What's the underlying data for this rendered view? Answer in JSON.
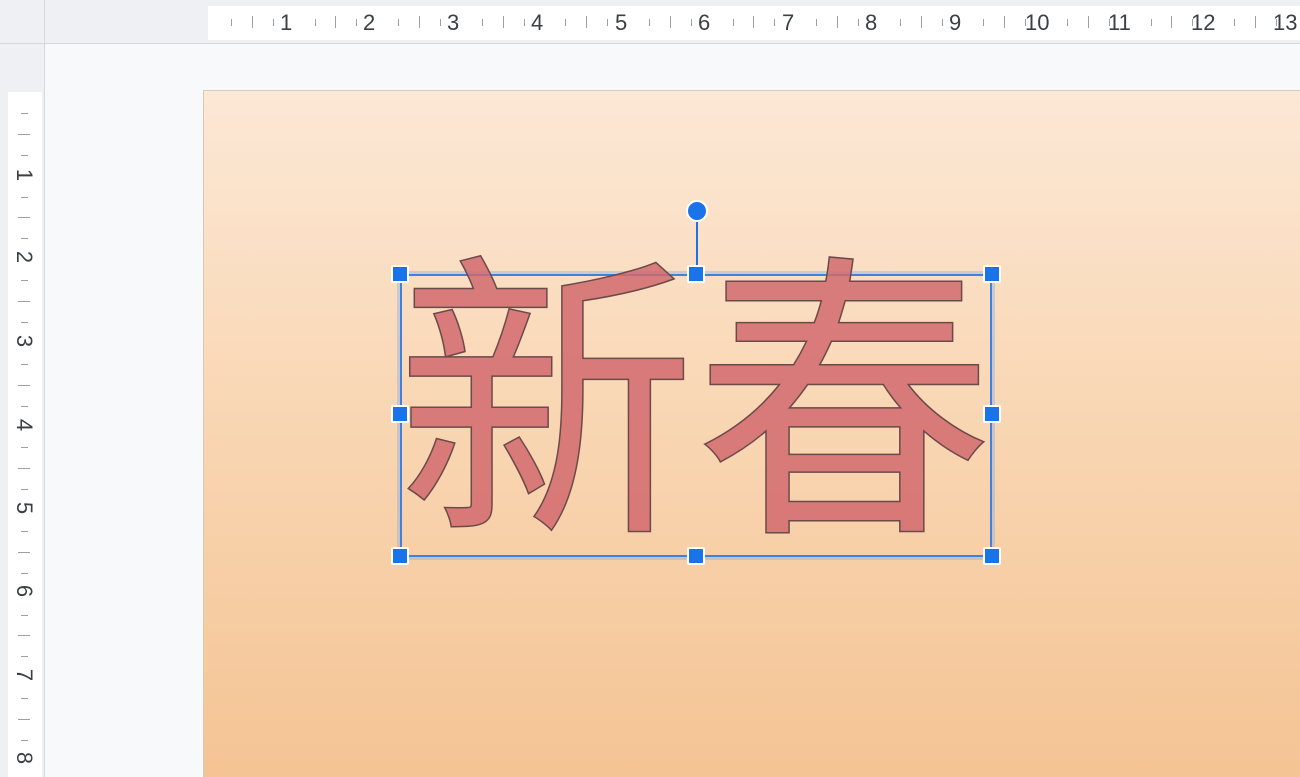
{
  "ruler": {
    "horizontal_labels": [
      "1",
      "2",
      "3",
      "4",
      "5",
      "6",
      "7",
      "8",
      "9",
      "10",
      "11",
      "12",
      "13"
    ],
    "vertical_labels": [
      "1",
      "2",
      "3",
      "4",
      "5",
      "6",
      "7",
      "8"
    ]
  },
  "slide": {
    "word_art_text": "新春"
  },
  "colors": {
    "selection": "#1a73e8",
    "slide_top": "#fce8d6",
    "slide_bottom": "#f4c393",
    "text_fill": "#dc6e73"
  }
}
